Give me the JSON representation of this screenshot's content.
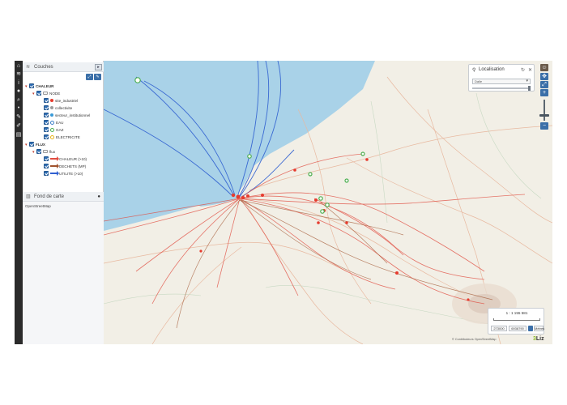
{
  "panel": {
    "layers_title": "Couches",
    "tree": [
      {
        "label": "CHALEUR",
        "level": 0,
        "kind": "group-checked",
        "bold": true
      },
      {
        "label": "NODE",
        "level": 1,
        "kind": "group-folder"
      },
      {
        "label": "site_industriel",
        "level": 2,
        "kind": "item",
        "symbol": "dot",
        "color": "#e63b2e"
      },
      {
        "label": "collectivite",
        "level": 2,
        "kind": "item",
        "symbol": "dot",
        "color": "#9b9b9b"
      },
      {
        "label": "secteur_institutionnel",
        "level": 2,
        "kind": "item",
        "symbol": "dot",
        "color": "#3a9bd8"
      },
      {
        "label": "EAU",
        "level": 2,
        "kind": "item",
        "symbol": "ring",
        "color": "#3a7fc9"
      },
      {
        "label": "GAZ",
        "level": 2,
        "kind": "item",
        "symbol": "ring",
        "color": "#4caf50"
      },
      {
        "label": "ELECTRICITE",
        "level": 2,
        "kind": "item",
        "symbol": "ring",
        "color": "#e7b416"
      },
      {
        "label": "FLUX",
        "level": 0,
        "kind": "group-checked",
        "bold": true
      },
      {
        "label": "flux",
        "level": 1,
        "kind": "group-folder"
      },
      {
        "label": "CHALEUR (>10)",
        "level": 2,
        "kind": "item",
        "symbol": "arrow",
        "color": "#e04b3f"
      },
      {
        "label": "DECHETS (MP)",
        "level": 2,
        "kind": "item",
        "symbol": "arrow",
        "color": "#a0522d"
      },
      {
        "label": "UTILITE (>10)",
        "level": 2,
        "kind": "item",
        "symbol": "arrow",
        "color": "#2f5fd0"
      }
    ],
    "basemap_title": "Fond de carte",
    "basemap_value": "OpenStreetMap"
  },
  "locate": {
    "title": "Localisation",
    "select_value": "Dalle"
  },
  "scale": {
    "label": "1 : 1 155 581",
    "x_coord": "273000",
    "y_coord": "6938790",
    "unit": "Mètres"
  },
  "attribution": "© Contributeurs OpenStreetMap",
  "logo": {
    "prefix": "3",
    "name": "Liz"
  },
  "map_labels": [],
  "colors": {
    "sea": "#a9d2e8",
    "land": "#f2efe6",
    "flux_heat": "#e04b3f",
    "flux_waste": "#a0522d",
    "flux_utility": "#2f5fd0",
    "node_red": "#e63b2e",
    "node_green": "#4caf50"
  }
}
